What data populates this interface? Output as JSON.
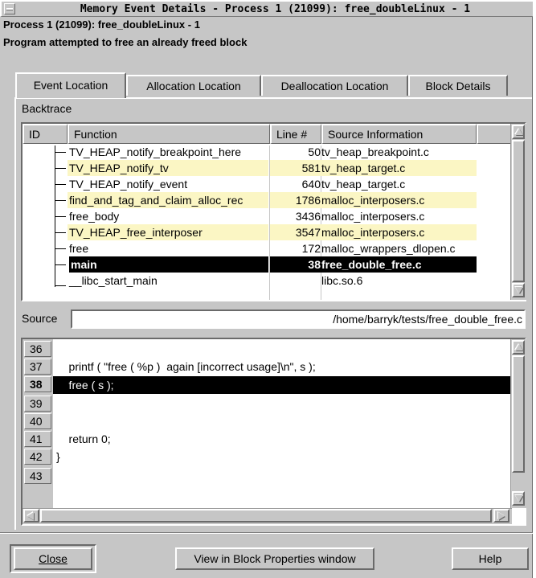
{
  "window": {
    "title": "Memory Event Details - Process 1 (21099): free_doubleLinux - 1"
  },
  "header": {
    "process_line": "Process 1 (21099): free_doubleLinux - 1",
    "message": "Program attempted to free an already freed block"
  },
  "tabs": [
    {
      "label": "Event Location",
      "active": true
    },
    {
      "label": "Allocation Location",
      "active": false
    },
    {
      "label": "Deallocation Location",
      "active": false
    },
    {
      "label": "Block Details",
      "active": false
    }
  ],
  "backtrace": {
    "label": "Backtrace",
    "columns": [
      "ID",
      "Function",
      "Line #",
      "Source Information"
    ],
    "rows": [
      {
        "function": "TV_HEAP_notify_breakpoint_here",
        "line": "50",
        "source": "tv_heap_breakpoint.c",
        "highlight": "none"
      },
      {
        "function": "TV_HEAP_notify_tv",
        "line": "581",
        "source": "tv_heap_target.c",
        "highlight": "yellow"
      },
      {
        "function": "TV_HEAP_notify_event",
        "line": "640",
        "source": "tv_heap_target.c",
        "highlight": "none"
      },
      {
        "function": "find_and_tag_and_claim_alloc_rec",
        "line": "1786",
        "source": "malloc_interposers.c",
        "highlight": "yellow"
      },
      {
        "function": "free_body",
        "line": "3436",
        "source": "malloc_interposers.c",
        "highlight": "none"
      },
      {
        "function": "TV_HEAP_free_interposer",
        "line": "3547",
        "source": "malloc_interposers.c",
        "highlight": "yellow"
      },
      {
        "function": "free",
        "line": "172",
        "source": "malloc_wrappers_dlopen.c",
        "highlight": "none"
      },
      {
        "function": "main",
        "line": "38",
        "source": "free_double_free.c",
        "highlight": "selected"
      },
      {
        "function": "__libc_start_main",
        "line": "",
        "source": "libc.so.6",
        "highlight": "none"
      }
    ]
  },
  "source": {
    "label": "Source",
    "path": "/home/barryk/tests/free_double_free.c",
    "lines": [
      {
        "num": "36",
        "text": "",
        "current": false
      },
      {
        "num": "37",
        "text": "    printf ( \"free ( %p )  again [incorrect usage]\\n\", s );",
        "current": false
      },
      {
        "num": "38",
        "text": "    free ( s );",
        "current": true
      },
      {
        "num": "39",
        "text": "",
        "current": false
      },
      {
        "num": "40",
        "text": "",
        "current": false
      },
      {
        "num": "41",
        "text": "    return 0;",
        "current": false
      },
      {
        "num": "42",
        "text": "}",
        "current": false
      },
      {
        "num": "43",
        "text": "",
        "current": false
      }
    ]
  },
  "buttons": {
    "close": "Close",
    "view_block": "View in Block Properties window",
    "help": "Help"
  },
  "colors": {
    "face": "#c6c6c6",
    "highlight_row": "#fbf6c4",
    "selection": "#000000"
  }
}
